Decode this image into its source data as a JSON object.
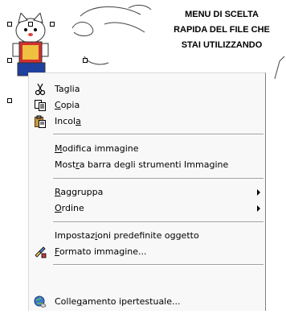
{
  "callout": {
    "line1": "MENU DI SCELTA",
    "line2": "RAPIDA DEL FILE CHE",
    "line3": "STAI UTILIZZANDO"
  },
  "menu": {
    "items": [
      {
        "pre": "",
        "acc": "",
        "post": "Taglia",
        "icon": "scissors-icon"
      },
      {
        "pre": "",
        "acc": "C",
        "post": "opia",
        "icon": "copy-icon"
      },
      {
        "pre": "Incol",
        "acc": "a",
        "post": "",
        "icon": "paste-icon"
      },
      {
        "pre": "",
        "acc": "M",
        "post": "odifica immagine",
        "icon": ""
      },
      {
        "pre": "Most",
        "acc": "r",
        "post": "a barra degli strumenti Immagine",
        "icon": ""
      },
      {
        "pre": "",
        "acc": "R",
        "post": "aggruppa",
        "icon": "",
        "submenu": true
      },
      {
        "pre": "",
        "acc": "O",
        "post": "rdine",
        "icon": "",
        "submenu": true
      },
      {
        "pre": "Impostaz",
        "acc": "i",
        "post": "oni predefinite oggetto",
        "icon": ""
      },
      {
        "pre": "",
        "acc": "F",
        "post": "ormato immagine...",
        "icon": "format-picture-icon"
      },
      {
        "pre": "Colle",
        "acc": "g",
        "post": "amento ipertestuale...",
        "icon": "hyperlink-icon"
      }
    ]
  }
}
